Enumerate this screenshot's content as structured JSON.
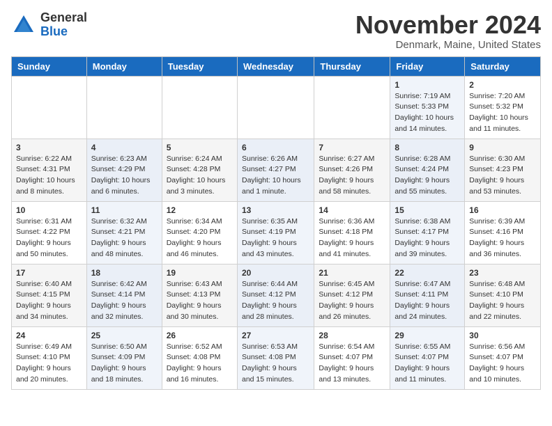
{
  "logo": {
    "general": "General",
    "blue": "Blue"
  },
  "header": {
    "month": "November 2024",
    "location": "Denmark, Maine, United States"
  },
  "weekdays": [
    "Sunday",
    "Monday",
    "Tuesday",
    "Wednesday",
    "Thursday",
    "Friday",
    "Saturday"
  ],
  "weeks": [
    [
      {
        "day": "",
        "info": ""
      },
      {
        "day": "",
        "info": ""
      },
      {
        "day": "",
        "info": ""
      },
      {
        "day": "",
        "info": ""
      },
      {
        "day": "",
        "info": ""
      },
      {
        "day": "1",
        "info": "Sunrise: 7:19 AM\nSunset: 5:33 PM\nDaylight: 10 hours and 14 minutes."
      },
      {
        "day": "2",
        "info": "Sunrise: 7:20 AM\nSunset: 5:32 PM\nDaylight: 10 hours and 11 minutes."
      }
    ],
    [
      {
        "day": "3",
        "info": "Sunrise: 6:22 AM\nSunset: 4:31 PM\nDaylight: 10 hours and 8 minutes."
      },
      {
        "day": "4",
        "info": "Sunrise: 6:23 AM\nSunset: 4:29 PM\nDaylight: 10 hours and 6 minutes."
      },
      {
        "day": "5",
        "info": "Sunrise: 6:24 AM\nSunset: 4:28 PM\nDaylight: 10 hours and 3 minutes."
      },
      {
        "day": "6",
        "info": "Sunrise: 6:26 AM\nSunset: 4:27 PM\nDaylight: 10 hours and 1 minute."
      },
      {
        "day": "7",
        "info": "Sunrise: 6:27 AM\nSunset: 4:26 PM\nDaylight: 9 hours and 58 minutes."
      },
      {
        "day": "8",
        "info": "Sunrise: 6:28 AM\nSunset: 4:24 PM\nDaylight: 9 hours and 55 minutes."
      },
      {
        "day": "9",
        "info": "Sunrise: 6:30 AM\nSunset: 4:23 PM\nDaylight: 9 hours and 53 minutes."
      }
    ],
    [
      {
        "day": "10",
        "info": "Sunrise: 6:31 AM\nSunset: 4:22 PM\nDaylight: 9 hours and 50 minutes."
      },
      {
        "day": "11",
        "info": "Sunrise: 6:32 AM\nSunset: 4:21 PM\nDaylight: 9 hours and 48 minutes."
      },
      {
        "day": "12",
        "info": "Sunrise: 6:34 AM\nSunset: 4:20 PM\nDaylight: 9 hours and 46 minutes."
      },
      {
        "day": "13",
        "info": "Sunrise: 6:35 AM\nSunset: 4:19 PM\nDaylight: 9 hours and 43 minutes."
      },
      {
        "day": "14",
        "info": "Sunrise: 6:36 AM\nSunset: 4:18 PM\nDaylight: 9 hours and 41 minutes."
      },
      {
        "day": "15",
        "info": "Sunrise: 6:38 AM\nSunset: 4:17 PM\nDaylight: 9 hours and 39 minutes."
      },
      {
        "day": "16",
        "info": "Sunrise: 6:39 AM\nSunset: 4:16 PM\nDaylight: 9 hours and 36 minutes."
      }
    ],
    [
      {
        "day": "17",
        "info": "Sunrise: 6:40 AM\nSunset: 4:15 PM\nDaylight: 9 hours and 34 minutes."
      },
      {
        "day": "18",
        "info": "Sunrise: 6:42 AM\nSunset: 4:14 PM\nDaylight: 9 hours and 32 minutes."
      },
      {
        "day": "19",
        "info": "Sunrise: 6:43 AM\nSunset: 4:13 PM\nDaylight: 9 hours and 30 minutes."
      },
      {
        "day": "20",
        "info": "Sunrise: 6:44 AM\nSunset: 4:12 PM\nDaylight: 9 hours and 28 minutes."
      },
      {
        "day": "21",
        "info": "Sunrise: 6:45 AM\nSunset: 4:12 PM\nDaylight: 9 hours and 26 minutes."
      },
      {
        "day": "22",
        "info": "Sunrise: 6:47 AM\nSunset: 4:11 PM\nDaylight: 9 hours and 24 minutes."
      },
      {
        "day": "23",
        "info": "Sunrise: 6:48 AM\nSunset: 4:10 PM\nDaylight: 9 hours and 22 minutes."
      }
    ],
    [
      {
        "day": "24",
        "info": "Sunrise: 6:49 AM\nSunset: 4:10 PM\nDaylight: 9 hours and 20 minutes."
      },
      {
        "day": "25",
        "info": "Sunrise: 6:50 AM\nSunset: 4:09 PM\nDaylight: 9 hours and 18 minutes."
      },
      {
        "day": "26",
        "info": "Sunrise: 6:52 AM\nSunset: 4:08 PM\nDaylight: 9 hours and 16 minutes."
      },
      {
        "day": "27",
        "info": "Sunrise: 6:53 AM\nSunset: 4:08 PM\nDaylight: 9 hours and 15 minutes."
      },
      {
        "day": "28",
        "info": "Sunrise: 6:54 AM\nSunset: 4:07 PM\nDaylight: 9 hours and 13 minutes."
      },
      {
        "day": "29",
        "info": "Sunrise: 6:55 AM\nSunset: 4:07 PM\nDaylight: 9 hours and 11 minutes."
      },
      {
        "day": "30",
        "info": "Sunrise: 6:56 AM\nSunset: 4:07 PM\nDaylight: 9 hours and 10 minutes."
      }
    ]
  ]
}
